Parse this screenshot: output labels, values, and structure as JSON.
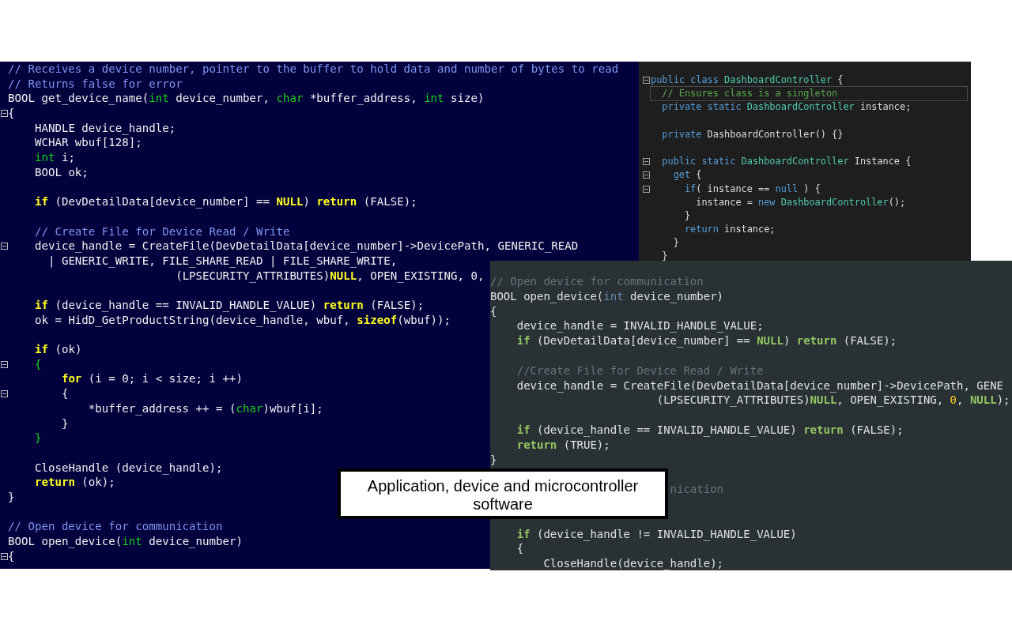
{
  "panels": [
    {
      "kind": "classic-blue",
      "lines": [
        {
          "kind": "code",
          "tokens": [
            {
              "text": "// Receives a device number, pointer to the buffer to hold data and number of bytes to read",
              "kind": "comment"
            }
          ]
        },
        {
          "kind": "code",
          "tokens": [
            {
              "text": "// Returns false for error",
              "kind": "comment"
            }
          ]
        },
        {
          "kind": "code",
          "tokens": [
            {
              "text": "BOOL get_device_name(",
              "kind": "plain"
            },
            {
              "text": "int",
              "kind": "type"
            },
            {
              "text": " device_number, ",
              "kind": "plain"
            },
            {
              "text": "char",
              "kind": "type"
            },
            {
              "text": " *buffer_address, ",
              "kind": "plain"
            },
            {
              "text": "int",
              "kind": "type"
            },
            {
              "text": " size)",
              "kind": "plain"
            }
          ]
        },
        {
          "kind": "code",
          "fold": true,
          "tokens": [
            {
              "text": "{",
              "kind": "plain"
            }
          ]
        },
        {
          "kind": "code",
          "tokens": [
            {
              "text": "    HANDLE device_handle;",
              "kind": "plain"
            }
          ]
        },
        {
          "kind": "code",
          "tokens": [
            {
              "text": "    WCHAR wbuf[128];",
              "kind": "plain"
            }
          ]
        },
        {
          "kind": "code",
          "tokens": [
            {
              "text": "    int",
              "kind": "type"
            },
            {
              "text": " i;",
              "kind": "plain"
            }
          ]
        },
        {
          "kind": "code",
          "tokens": [
            {
              "text": "    BOOL ok;",
              "kind": "plain"
            }
          ]
        },
        {
          "kind": "blank"
        },
        {
          "kind": "code",
          "tokens": [
            {
              "text": "    if",
              "kind": "keyword"
            },
            {
              "text": " (DevDetailData[device_number] == ",
              "kind": "plain"
            },
            {
              "text": "NULL",
              "kind": "keyword"
            },
            {
              "text": ") ",
              "kind": "plain"
            },
            {
              "text": "return",
              "kind": "keyword"
            },
            {
              "text": " (FALSE);",
              "kind": "plain"
            }
          ]
        },
        {
          "kind": "blank"
        },
        {
          "kind": "code",
          "tokens": [
            {
              "text": "    // Create File for Device Read / Write",
              "kind": "comment"
            }
          ]
        },
        {
          "kind": "code",
          "fold": true,
          "tokens": [
            {
              "text": "    device_handle = CreateFile(DevDetailData[device_number]->DevicePath, GENERIC_READ",
              "kind": "plain"
            }
          ]
        },
        {
          "kind": "code",
          "tokens": [
            {
              "text": "      | GENERIC_WRITE, FILE_SHARE_READ | FILE_SHARE_WRITE,",
              "kind": "plain"
            }
          ]
        },
        {
          "kind": "code",
          "tokens": [
            {
              "text": "                         (LPSECURITY_ATTRIBUTES)",
              "kind": "plain"
            },
            {
              "text": "NULL",
              "kind": "keyword"
            },
            {
              "text": ", OPEN_EXISTING, 0,",
              "kind": "plain"
            }
          ]
        },
        {
          "kind": "blank"
        },
        {
          "kind": "code",
          "tokens": [
            {
              "text": "    if",
              "kind": "keyword"
            },
            {
              "text": " (device_handle == INVALID_HANDLE_VALUE) ",
              "kind": "plain"
            },
            {
              "text": "return",
              "kind": "keyword"
            },
            {
              "text": " (FALSE);",
              "kind": "plain"
            }
          ]
        },
        {
          "kind": "code",
          "tokens": [
            {
              "text": "    ok = HidD_GetProductString(device_handle, wbuf, ",
              "kind": "plain"
            },
            {
              "text": "sizeof",
              "kind": "keyword"
            },
            {
              "text": "(wbuf));",
              "kind": "plain"
            }
          ]
        },
        {
          "kind": "blank"
        },
        {
          "kind": "code",
          "tokens": [
            {
              "text": "    if",
              "kind": "keyword"
            },
            {
              "text": " (ok)",
              "kind": "plain"
            }
          ]
        },
        {
          "kind": "code",
          "fold": true,
          "tokens": [
            {
              "text": "    {",
              "kind": "type"
            }
          ]
        },
        {
          "kind": "code",
          "tokens": [
            {
              "text": "        for",
              "kind": "keyword"
            },
            {
              "text": " (i = 0; i < size; i ++)",
              "kind": "plain"
            }
          ]
        },
        {
          "kind": "code",
          "fold": true,
          "tokens": [
            {
              "text": "        {",
              "kind": "plain"
            }
          ]
        },
        {
          "kind": "code",
          "tokens": [
            {
              "text": "            *buffer_address ++ = (",
              "kind": "plain"
            },
            {
              "text": "char",
              "kind": "type"
            },
            {
              "text": ")wbuf[i];",
              "kind": "plain"
            }
          ]
        },
        {
          "kind": "code",
          "tokens": [
            {
              "text": "        }",
              "kind": "plain"
            }
          ]
        },
        {
          "kind": "code",
          "tokens": [
            {
              "text": "    }",
              "kind": "type"
            }
          ]
        },
        {
          "kind": "blank"
        },
        {
          "kind": "code",
          "tokens": [
            {
              "text": "    CloseHandle (device_handle);",
              "kind": "plain"
            }
          ]
        },
        {
          "kind": "code",
          "tokens": [
            {
              "text": "    return",
              "kind": "keyword"
            },
            {
              "text": " (ok);",
              "kind": "plain"
            }
          ]
        },
        {
          "kind": "code",
          "tokens": [
            {
              "text": "}",
              "kind": "plain"
            }
          ]
        },
        {
          "kind": "blank"
        },
        {
          "kind": "code",
          "tokens": [
            {
              "text": "// Open device for communication",
              "kind": "comment"
            }
          ]
        },
        {
          "kind": "code",
          "tokens": [
            {
              "text": "BOOL open_device(",
              "kind": "plain"
            },
            {
              "text": "int",
              "kind": "type"
            },
            {
              "text": " device_number)",
              "kind": "plain"
            }
          ]
        },
        {
          "kind": "code",
          "fold": true,
          "tokens": [
            {
              "text": "{",
              "kind": "plain"
            }
          ]
        }
      ]
    },
    {
      "kind": "vs-dark",
      "lines": [
        {
          "kind": "code",
          "fold": true,
          "tokens": [
            {
              "text": "public class ",
              "kind": "keyword"
            },
            {
              "text": "DashboardController",
              "kind": "type"
            },
            {
              "text": " {",
              "kind": "plain"
            }
          ]
        },
        {
          "kind": "code",
          "current": true,
          "tokens": [
            {
              "text": "  // Ensures class is a singleton",
              "kind": "comment"
            }
          ]
        },
        {
          "kind": "code",
          "tokens": [
            {
              "text": "  private static ",
              "kind": "keyword"
            },
            {
              "text": "DashboardController",
              "kind": "type"
            },
            {
              "text": " instance;",
              "kind": "plain"
            }
          ]
        },
        {
          "kind": "blank"
        },
        {
          "kind": "code",
          "tokens": [
            {
              "text": "  private",
              "kind": "keyword"
            },
            {
              "text": " DashboardController() {}",
              "kind": "plain"
            }
          ]
        },
        {
          "kind": "blank"
        },
        {
          "kind": "code",
          "fold": true,
          "tokens": [
            {
              "text": "  public static ",
              "kind": "keyword"
            },
            {
              "text": "DashboardController",
              "kind": "type"
            },
            {
              "text": " Instance {",
              "kind": "plain"
            }
          ]
        },
        {
          "kind": "code",
          "fold": true,
          "tokens": [
            {
              "text": "    get",
              "kind": "keyword"
            },
            {
              "text": " {",
              "kind": "plain"
            }
          ]
        },
        {
          "kind": "code",
          "fold": true,
          "tokens": [
            {
              "text": "      if",
              "kind": "keyword"
            },
            {
              "text": "( instance == ",
              "kind": "plain"
            },
            {
              "text": "null",
              "kind": "keyword"
            },
            {
              "text": " ) {",
              "kind": "plain"
            }
          ]
        },
        {
          "kind": "code",
          "tokens": [
            {
              "text": "        instance = ",
              "kind": "plain"
            },
            {
              "text": "new ",
              "kind": "keyword"
            },
            {
              "text": "DashboardController",
              "kind": "type"
            },
            {
              "text": "();",
              "kind": "plain"
            }
          ]
        },
        {
          "kind": "code",
          "tokens": [
            {
              "text": "      }",
              "kind": "plain"
            }
          ]
        },
        {
          "kind": "code",
          "tokens": [
            {
              "text": "      return",
              "kind": "keyword"
            },
            {
              "text": " instance;",
              "kind": "plain"
            }
          ]
        },
        {
          "kind": "code",
          "tokens": [
            {
              "text": "    }",
              "kind": "plain"
            }
          ]
        },
        {
          "kind": "code",
          "tokens": [
            {
              "text": "  }",
              "kind": "plain"
            }
          ]
        }
      ]
    },
    {
      "kind": "slate",
      "lines": [
        {
          "kind": "code",
          "tokens": [
            {
              "text": "// Open device for communication",
              "kind": "comment"
            }
          ]
        },
        {
          "kind": "code",
          "tokens": [
            {
              "text": "BOOL open_device(",
              "kind": "plain"
            },
            {
              "text": "int",
              "kind": "type"
            },
            {
              "text": " device_number)",
              "kind": "plain"
            }
          ]
        },
        {
          "kind": "code",
          "tokens": [
            {
              "text": "{",
              "kind": "plain"
            }
          ]
        },
        {
          "kind": "code",
          "tokens": [
            {
              "text": "    device_handle = INVALID_HANDLE_VALUE;",
              "kind": "plain"
            }
          ]
        },
        {
          "kind": "code",
          "tokens": [
            {
              "text": "    if",
              "kind": "keyword"
            },
            {
              "text": " (DevDetailData[device_number] == ",
              "kind": "plain"
            },
            {
              "text": "NULL",
              "kind": "keyword"
            },
            {
              "text": ") ",
              "kind": "plain"
            },
            {
              "text": "return",
              "kind": "keyword"
            },
            {
              "text": " (FALSE);",
              "kind": "plain"
            }
          ]
        },
        {
          "kind": "blank"
        },
        {
          "kind": "code",
          "tokens": [
            {
              "text": "    //Create File for Device Read / Write",
              "kind": "comment"
            }
          ]
        },
        {
          "kind": "code",
          "tokens": [
            {
              "text": "    device_handle = CreateFile(DevDetailData[device_number]->DevicePath, GENE",
              "kind": "plain"
            }
          ]
        },
        {
          "kind": "code",
          "tokens": [
            {
              "text": "                         (LPSECURITY_ATTRIBUTES)",
              "kind": "plain"
            },
            {
              "text": "NULL",
              "kind": "keyword"
            },
            {
              "text": ", OPEN_EXISTING, ",
              "kind": "plain"
            },
            {
              "text": "0",
              "kind": "number"
            },
            {
              "text": ", ",
              "kind": "plain"
            },
            {
              "text": "NULL",
              "kind": "keyword"
            },
            {
              "text": ");",
              "kind": "plain"
            }
          ]
        },
        {
          "kind": "blank"
        },
        {
          "kind": "code",
          "tokens": [
            {
              "text": "    if",
              "kind": "keyword"
            },
            {
              "text": " (device_handle == INVALID_HANDLE_VALUE) ",
              "kind": "plain"
            },
            {
              "text": "return",
              "kind": "keyword"
            },
            {
              "text": " (FALSE);",
              "kind": "plain"
            }
          ]
        },
        {
          "kind": "code",
          "tokens": [
            {
              "text": "    return",
              "kind": "keyword"
            },
            {
              "text": " (TRUE);",
              "kind": "plain"
            }
          ]
        },
        {
          "kind": "code",
          "tokens": [
            {
              "text": "}",
              "kind": "plain"
            }
          ]
        },
        {
          "kind": "blank"
        },
        {
          "kind": "code",
          "tokens": [
            {
              "text": "                           nication",
              "kind": "comment"
            }
          ]
        },
        {
          "kind": "blank"
        },
        {
          "kind": "blank"
        },
        {
          "kind": "code",
          "tokens": [
            {
              "text": "    if",
              "kind": "keyword"
            },
            {
              "text": " (device_handle != INVALID_HANDLE_VALUE)",
              "kind": "plain"
            }
          ]
        },
        {
          "kind": "code",
          "tokens": [
            {
              "text": "    {",
              "kind": "plain"
            }
          ]
        },
        {
          "kind": "code",
          "tokens": [
            {
              "text": "        CloseHandle(device_handle);",
              "kind": "plain"
            }
          ]
        }
      ]
    }
  ],
  "caption": "Application, device and microcontroller software"
}
